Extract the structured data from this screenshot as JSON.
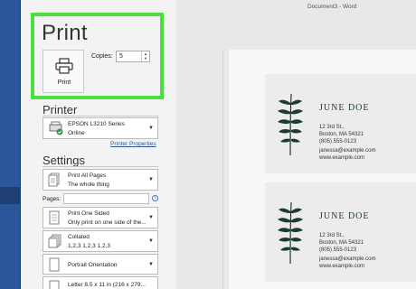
{
  "app": {
    "window_title": "Document3 - Word"
  },
  "print": {
    "title": "Print",
    "button_label": "Print",
    "copies_label": "Copies:",
    "copies_value": "5"
  },
  "printer": {
    "section_title": "Printer",
    "name": "EPSON L3210 Series",
    "status": "Online",
    "properties_link": "Printer Properties"
  },
  "settings": {
    "section_title": "Settings",
    "print_range": {
      "line1": "Print All Pages",
      "line2": "The whole thing"
    },
    "pages_label": "Pages:",
    "pages_value": "",
    "sides": {
      "line1": "Print One Sided",
      "line2": "Only print on one side of the..."
    },
    "collation": {
      "line1": "Collated",
      "line2": "1,2,3    1,2,3    1,2,3"
    },
    "orientation": {
      "line1": "Portrait Orientation"
    },
    "paper_size": {
      "line1": "Letter 8.5 x 11 in (216 x 279..."
    }
  },
  "preview": {
    "cards": [
      {
        "name": "JUNE DOE",
        "lines": [
          "12 3rd St.,",
          "Boston, MA 54321",
          "(805) 555-0123",
          "janessa@example.com",
          "www.example.com"
        ]
      },
      {
        "name": "JUNE DOE",
        "lines": [
          "12 3rd St.,",
          "Boston, MA 54321",
          "(805) 555-0123",
          "janessa@example.com",
          "www.example.com"
        ]
      }
    ]
  },
  "colors": {
    "accent_blue": "#2b579a",
    "highlight_green": "#4cde3e",
    "leaf_green": "#1d3a34"
  },
  "icons": [
    "printer-icon",
    "printer-online-icon",
    "pages-icon",
    "one-sided-icon",
    "collated-icon",
    "portrait-icon",
    "paper-icon",
    "fern-leaf-icon",
    "info-icon",
    "chevron-down-icon"
  ]
}
